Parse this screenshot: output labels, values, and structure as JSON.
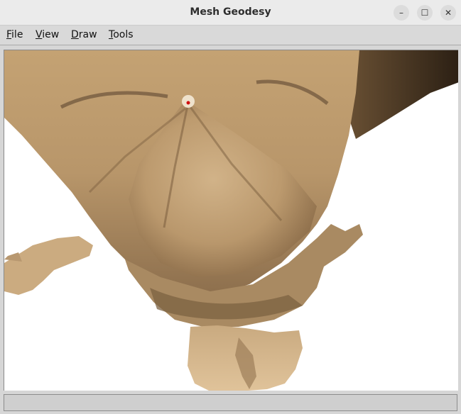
{
  "window": {
    "title": "Mesh Geodesy",
    "controls": {
      "minimize_glyph": "–",
      "maximize_glyph": "☐",
      "close_glyph": "✕"
    }
  },
  "menu": {
    "items": [
      {
        "mnemonic": "F",
        "rest": "ile"
      },
      {
        "mnemonic": "V",
        "rest": "iew"
      },
      {
        "mnemonic": "D",
        "rest": "raw"
      },
      {
        "mnemonic": "T",
        "rest": "ools"
      }
    ]
  },
  "viewport": {
    "mesh_color": "#c8a97e",
    "shadow_color": "#3a2c1c",
    "background": "#ffffff",
    "source_point_color": "#d01010"
  },
  "status": {
    "text": ""
  }
}
